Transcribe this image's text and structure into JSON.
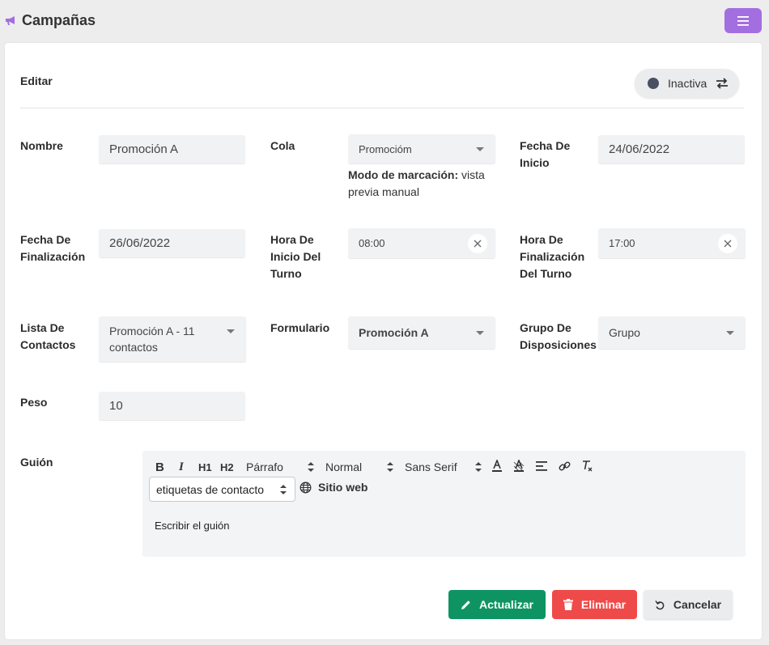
{
  "header": {
    "title": "Campañas",
    "icon": "megaphone-icon",
    "accent_color": "#a36ee0",
    "menu_icon": "hamburger-menu-icon"
  },
  "form": {
    "title": "Editar",
    "status": {
      "label": "Inactiva",
      "dot_color": "#4a5061",
      "icon": "swap-arrows-icon"
    },
    "fields": {
      "nombre": {
        "label": "Nombre",
        "value": "Promoción  A"
      },
      "cola": {
        "label": "Cola",
        "value": "Promocióm",
        "hint_bold": "Modo de marcación:",
        "hint_text": " vista previa manual"
      },
      "fecha_inicio": {
        "label": "Fecha De Inicio",
        "value": "24/06/2022"
      },
      "fecha_fin": {
        "label": "Fecha De Finalización",
        "value": "26/06/2022"
      },
      "hora_inicio": {
        "label": "Hora De Inicio Del Turno",
        "value": "08:00"
      },
      "hora_fin": {
        "label": "Hora De Finalización Del Turno",
        "value": "17:00"
      },
      "lista_contactos": {
        "label": "Lista De Contactos",
        "value": "Promoción A - 11 contactos"
      },
      "formulario": {
        "label": "Formulario",
        "value": "Promoción A"
      },
      "grupo_disposiciones": {
        "label": "Grupo De Disposiciones",
        "value": "Grupo"
      },
      "peso": {
        "label": "Peso",
        "value": "10"
      },
      "guion": {
        "label": "Guión"
      }
    },
    "editor": {
      "bold": "B",
      "italic": "I",
      "h1": "H1",
      "h2": "H2",
      "paragraph_select": "Párrafo",
      "size_select": "Normal",
      "font_select": "Sans Serif",
      "tags_select": "etiquetas de contacto",
      "website_label": "Sitio web",
      "placeholder": "Escribir el guión"
    },
    "buttons": {
      "update": {
        "label": "Actualizar",
        "color": "#0e9462"
      },
      "delete": {
        "label": "Eliminar",
        "color": "#ef4a4a"
      },
      "cancel": {
        "label": "Cancelar",
        "color": "#ebecee"
      }
    }
  }
}
